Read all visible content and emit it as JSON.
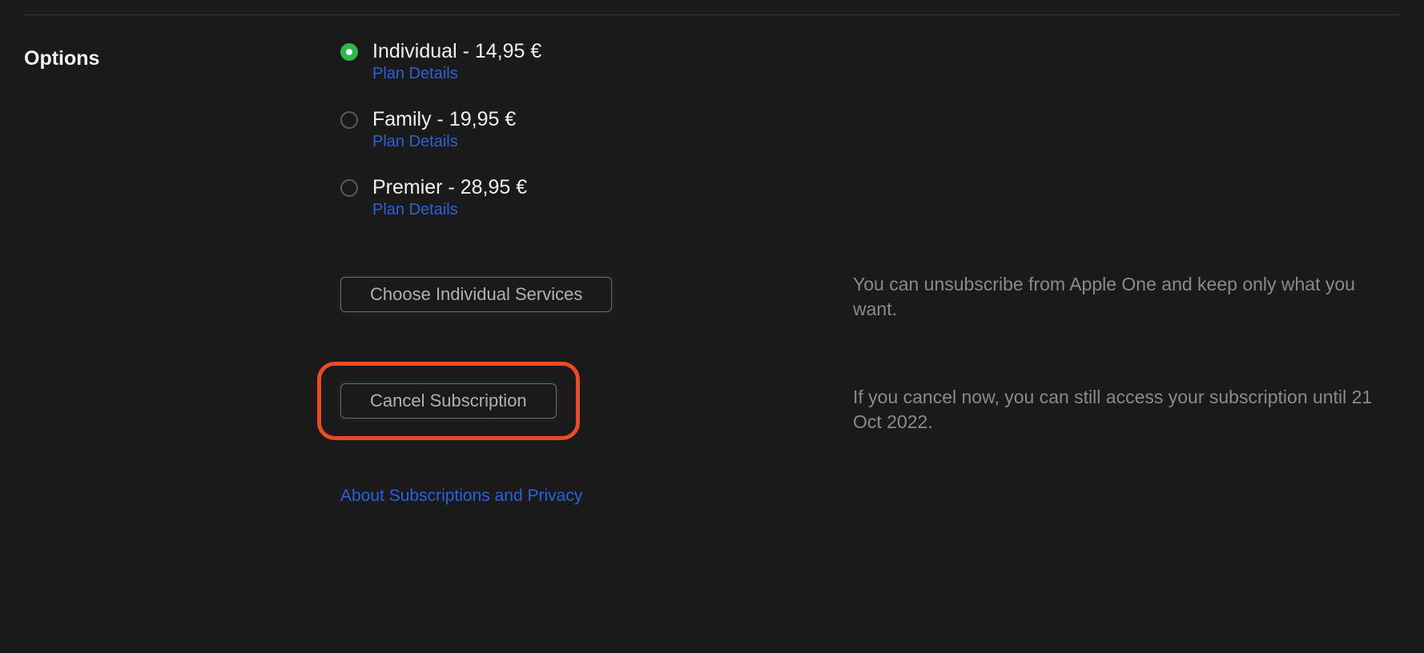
{
  "section": {
    "title": "Options"
  },
  "plans": [
    {
      "label": "Individual - 14,95 €",
      "details_link": "Plan Details",
      "selected": true
    },
    {
      "label": "Family - 19,95 €",
      "details_link": "Plan Details",
      "selected": false
    },
    {
      "label": "Premier - 28,95 €",
      "details_link": "Plan Details",
      "selected": false
    }
  ],
  "buttons": {
    "choose_services": "Choose Individual Services",
    "cancel_subscription": "Cancel Subscription"
  },
  "descriptions": {
    "choose_services": "You can unsubscribe from Apple One and keep only what you want.",
    "cancel_subscription": "If you cancel now, you can still access your subscription until 21 Oct 2022."
  },
  "footer": {
    "privacy_link": "About Subscriptions and Privacy"
  }
}
